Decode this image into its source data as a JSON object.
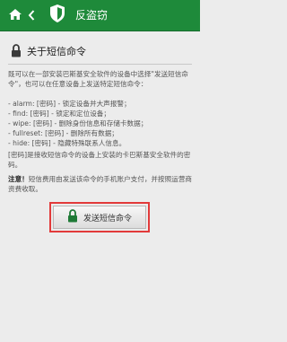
{
  "header": {
    "title": "反盗窃",
    "home_icon": "home-icon",
    "back_icon": "chevron-left-icon",
    "shield_icon": "shield-icon",
    "color": "#1e8a3a"
  },
  "section": {
    "title": "关于短信命令",
    "icon": "lock-icon"
  },
  "intro": "既可以在一部安装巴斯基安全软件的设备中选择\"发送短信命令\"，也可以在任意设备上发送特定短信命令：",
  "commands": [
    "- alarm: [密码] - 锁定设备并大声报警；",
    "- find: [密码] - 锁定和定位设备；",
    "- wipe: [密码] - 删除身份信息和存储卡数据；",
    "- fullreset: [密码] - 删除所有数据；",
    "- hide: [密码] - 隐藏特殊联系人信息。"
  ],
  "password_note": "[密码]是接收短信命令的设备上安装的卡巴斯基安全软件的密码。",
  "attention": {
    "label": "注意！",
    "text": "短信费用由发送该命令的手机账户支付，并按照运营商资费收取。"
  },
  "button": {
    "label": "发送短信命令",
    "icon": "lock-icon",
    "highlight_color": "#e23a3a"
  }
}
